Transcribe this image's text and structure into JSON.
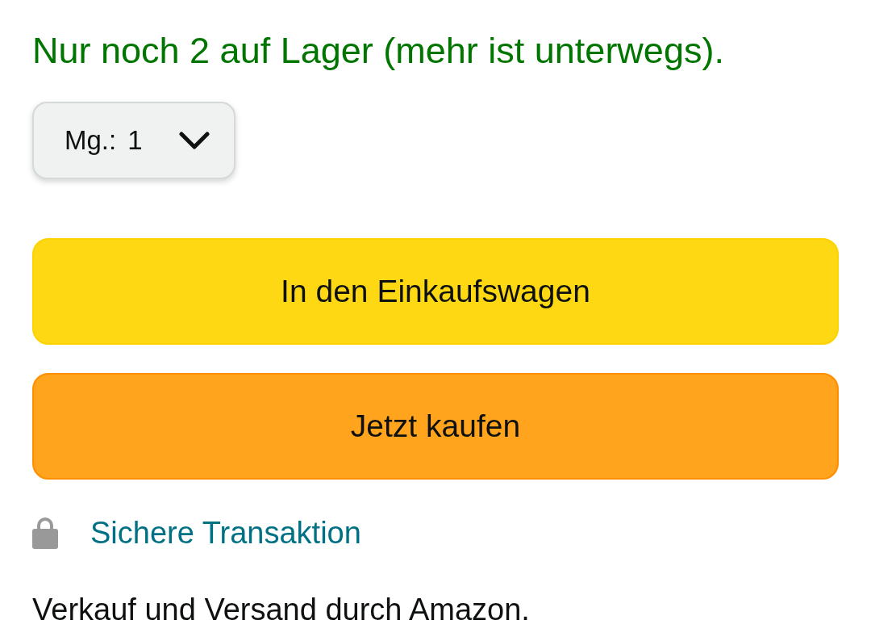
{
  "availability": {
    "text": "Nur noch 2 auf Lager (mehr ist unterwegs)."
  },
  "quantity": {
    "label": "Mg.:",
    "value": "1"
  },
  "buttons": [
    {
      "kind": "cart",
      "label": "In den Einkaufswagen"
    },
    {
      "kind": "buy",
      "label": "Jetzt kaufen"
    }
  ],
  "secure_link": {
    "label": "Sichere Transaktion"
  },
  "seller_note": "Verkauf und Versand durch Amazon."
}
